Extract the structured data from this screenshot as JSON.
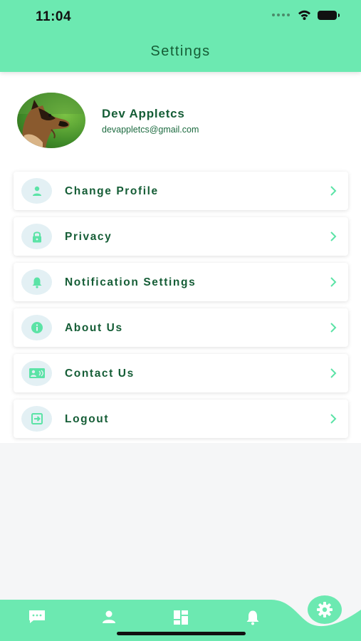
{
  "status_bar": {
    "time": "11:04"
  },
  "header": {
    "title": "Settings"
  },
  "profile": {
    "name": "Dev Appletcs",
    "email": "devappletcs@gmail.com"
  },
  "menu": {
    "items": [
      {
        "label": "Change Profile",
        "icon": "person-icon"
      },
      {
        "label": "Privacy",
        "icon": "lock-icon"
      },
      {
        "label": "Notification Settings",
        "icon": "bell-icon"
      },
      {
        "label": "About Us",
        "icon": "info-icon"
      },
      {
        "label": "Contact Us",
        "icon": "contact-card-icon"
      },
      {
        "label": "Logout",
        "icon": "logout-icon"
      }
    ]
  },
  "bottom_nav": {
    "items": [
      "chat-icon",
      "person-icon",
      "dashboard-icon",
      "bell-icon",
      "settings-gear-icon"
    ],
    "active": "settings-gear-icon"
  },
  "colors": {
    "accent": "#6ce9b1",
    "text_dark_green": "#155d36",
    "icon_bg": "#e3f0f4",
    "icon_fg": "#5be3a6"
  }
}
